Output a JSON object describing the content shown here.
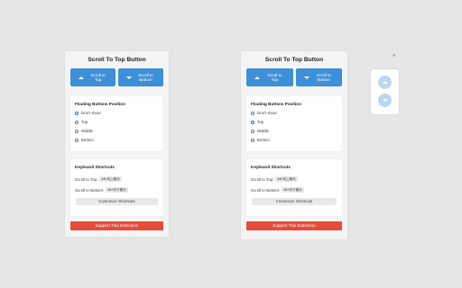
{
  "popup": {
    "title": "Scroll To Top Button",
    "scroll_top_label": "Scroll to Top",
    "scroll_bottom_label": "Scroll to Bottom",
    "position_section": {
      "title": "Floating Buttons Position",
      "options": [
        "Don't show",
        "Top",
        "Middle",
        "Bottom"
      ]
    },
    "shortcuts_section": {
      "title": "Keyboard Shortcuts",
      "scroll_top_label": "Scroll to Top:",
      "scroll_top_key": "Alt+向上箭头",
      "scroll_bottom_label": "Scroll to Bottom:",
      "scroll_bottom_key": "Alt+向下箭头",
      "customize_label": "Customize Shortcuts"
    },
    "support_label": "Support This Extension"
  },
  "left_popup_selected": "Don't show",
  "right_popup_selected": "Top",
  "floater": {
    "close_glyph": "»"
  },
  "colors": {
    "primary": "#3d8fd8",
    "danger": "#e54c3c",
    "float_button": "#bcd7f2"
  }
}
